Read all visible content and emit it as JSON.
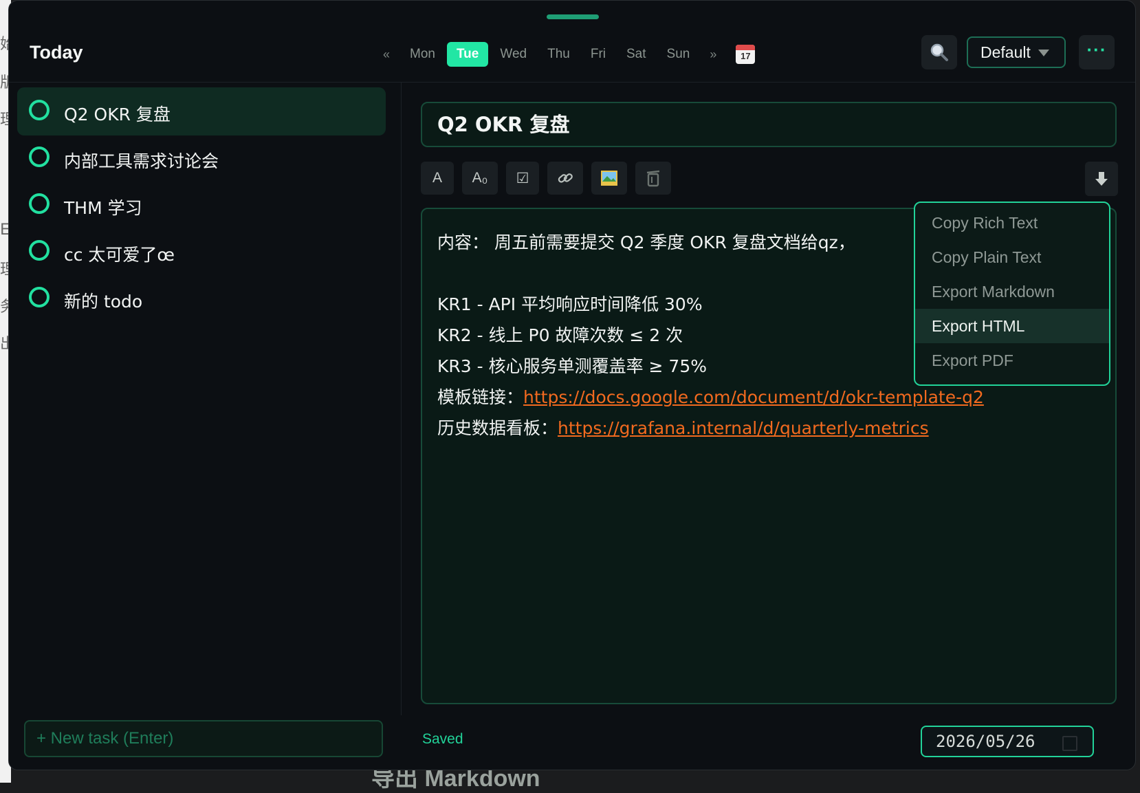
{
  "background": {
    "left_chars": [
      "始",
      "版",
      "理",
      "E",
      "理",
      "务",
      "出"
    ],
    "bottom_text": "导出 Markdown"
  },
  "header": {
    "title": "Today",
    "prev": "«",
    "next": "»",
    "days": [
      {
        "label": "Mon",
        "active": false
      },
      {
        "label": "Tue",
        "active": true
      },
      {
        "label": "Wed",
        "active": false
      },
      {
        "label": "Thu",
        "active": false
      },
      {
        "label": "Fri",
        "active": false
      },
      {
        "label": "Sat",
        "active": false
      },
      {
        "label": "Sun",
        "active": false
      }
    ],
    "calendar_day": "17",
    "profile": "Default",
    "more": "···"
  },
  "tasks": [
    {
      "label": "Q2 OKR 复盘",
      "selected": true
    },
    {
      "label": "内部工具需求讨论会",
      "selected": false
    },
    {
      "label": "THM 学习",
      "selected": false
    },
    {
      "label": "cc 太可爱了œ",
      "selected": false
    },
    {
      "label": "新的 todo",
      "selected": false
    }
  ],
  "new_task": {
    "placeholder": "+ New task (Enter)"
  },
  "editor": {
    "title": "Q2 OKR 复盘",
    "toolbar": {
      "text": "A",
      "heading": "A₀",
      "checkbox": "☑"
    },
    "content": {
      "line1": "内容： 周五前需要提交 Q2 季度 OKR 复盘文档给qz，",
      "kr1": "KR1 - API 平均响应时间降低 30%",
      "kr2": "KR2 - 线上 P0 故障次数 ≤ 2 次",
      "kr3": "KR3 - 核心服务单测覆盖率 ≥ 75%",
      "template_label": "模板链接：",
      "template_url": "https://docs.google.com/document/d/okr-template-q2",
      "history_label": "历史数据看板：",
      "history_url": "https://grafana.internal/d/quarterly-metrics"
    }
  },
  "status": "Saved",
  "date": "2026/05/26",
  "export_menu": {
    "items": [
      {
        "label": "Copy Rich Text",
        "active": false
      },
      {
        "label": "Copy Plain Text",
        "active": false
      },
      {
        "label": "Export Markdown",
        "active": false
      },
      {
        "label": "Export HTML",
        "active": true
      },
      {
        "label": "Export PDF",
        "active": false
      }
    ]
  },
  "colors": {
    "accent": "#22e0a0",
    "link": "#f26a1f",
    "window_bg": "#0c0f13"
  }
}
